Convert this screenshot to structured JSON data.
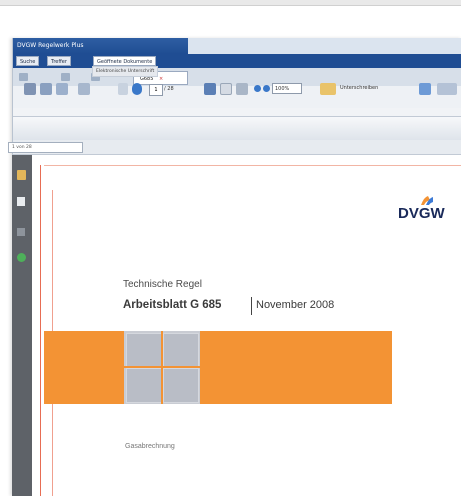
{
  "window": {
    "title": "DVGW Regelwerk Plus"
  },
  "menu": {
    "items": [
      "Suche",
      "Treffer",
      "Geöffnete Dokumente"
    ]
  },
  "tab": {
    "label": "G685"
  },
  "subtoolbar": {
    "label": "Elektronische Unterschrift"
  },
  "toolbar": {
    "page_value": "1",
    "page_of": "/ 28",
    "zoom": "100%",
    "sign_label": "Unterschreiben"
  },
  "pagebar": {
    "selector": "1 von 28"
  },
  "document": {
    "logo": "DVGW",
    "heading": "Technische Regel",
    "title": "Arbeitsblatt G 685",
    "date": "November 2008",
    "footer": "Gasabrechnung"
  },
  "colors": {
    "brand_blue": "#1f4d93",
    "accent_orange": "#f39334",
    "sidebar_grey": "#5e6268"
  }
}
